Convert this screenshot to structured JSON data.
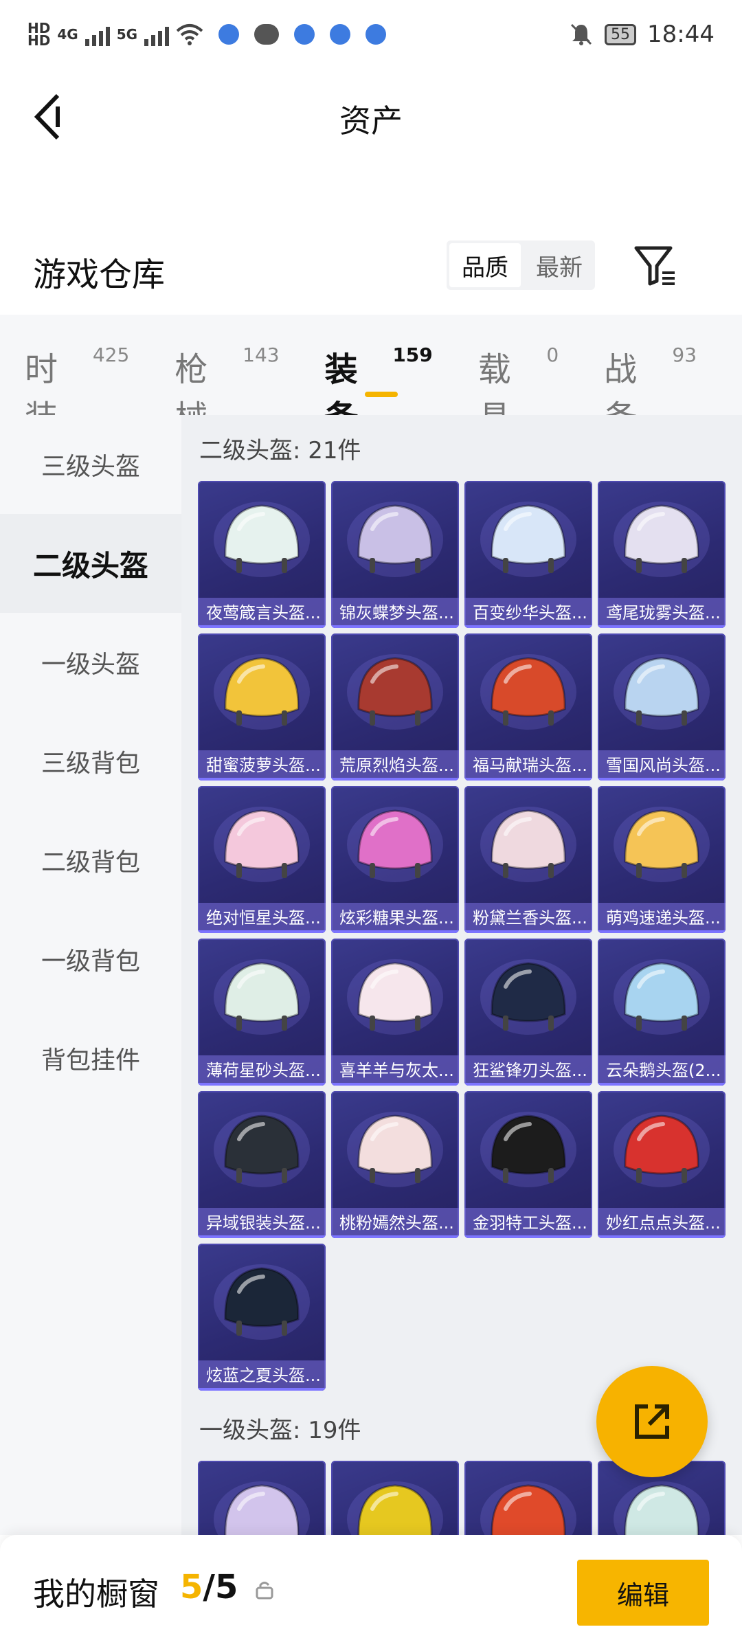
{
  "status_bar": {
    "hd1": "HD",
    "hd2": "HD",
    "net1": "4G",
    "net2": "5G",
    "battery": "55",
    "time": "18:44"
  },
  "header": {
    "title": "资产"
  },
  "warehouse": {
    "title": "游戏仓库",
    "sort_options": [
      "品质",
      "最新"
    ],
    "active_sort": "品质"
  },
  "tabs": [
    {
      "label": "时装",
      "count": "425"
    },
    {
      "label": "枪械",
      "count": "143"
    },
    {
      "label": "装备",
      "count": "159",
      "active": true
    },
    {
      "label": "载具",
      "count": "0"
    },
    {
      "label": "战备",
      "count": "93"
    }
  ],
  "sidebar": {
    "items": [
      "三级头盔",
      "二级头盔",
      "一级头盔",
      "三级背包",
      "二级背包",
      "一级背包",
      "背包挂件"
    ],
    "active": "二级头盔"
  },
  "sections": [
    {
      "title": "二级头盔: 21件",
      "items": [
        {
          "name": "夜莺箴言头盔...",
          "color": "#e6f2ee"
        },
        {
          "name": "锦灰蝶梦头盔...",
          "color": "#c9c0e6"
        },
        {
          "name": "百变纱华头盔...",
          "color": "#d8e6f8"
        },
        {
          "name": "鸢尾珑雾头盔...",
          "color": "#e4e0f0"
        },
        {
          "name": "甜蜜菠萝头盔...",
          "color": "#f2c43a"
        },
        {
          "name": "荒原烈焰头盔...",
          "color": "#a83a30"
        },
        {
          "name": "福马献瑞头盔...",
          "color": "#d84a2a"
        },
        {
          "name": "雪国风尚头盔...",
          "color": "#b9d4f0"
        },
        {
          "name": "绝对恒星头盔...",
          "color": "#f4c8dc"
        },
        {
          "name": "炫彩糖果头盔...",
          "color": "#e070c8"
        },
        {
          "name": "粉黛兰香头盔...",
          "color": "#efd9df"
        },
        {
          "name": "萌鸡速递头盔...",
          "color": "#f5c456"
        },
        {
          "name": "薄荷星砂头盔...",
          "color": "#dfeee6"
        },
        {
          "name": "喜羊羊与灰太...",
          "color": "#f6e6ec"
        },
        {
          "name": "狂鲨锋刃头盔...",
          "color": "#1f2a46"
        },
        {
          "name": "云朵鹅头盔(2...",
          "color": "#a8d4f0"
        },
        {
          "name": "异域银装头盔...",
          "color": "#2a3038"
        },
        {
          "name": "桃粉嫣然头盔...",
          "color": "#f3dede"
        },
        {
          "name": "金羽特工头盔...",
          "color": "#1c1c1c"
        },
        {
          "name": "妙红点点头盔...",
          "color": "#d8322e"
        },
        {
          "name": "炫蓝之夏头盔...",
          "color": "#1b2638"
        }
      ]
    },
    {
      "title": "一级头盔: 19件",
      "items": [
        {
          "name": "",
          "color": "#d2c4ec"
        },
        {
          "name": "",
          "color": "#e6c820"
        },
        {
          "name": "",
          "color": "#e04a2a"
        },
        {
          "name": "",
          "color": "#cfe8e4"
        }
      ]
    }
  ],
  "bottom_bar": {
    "label": "我的橱窗",
    "count_current": "5",
    "count_sep": "/",
    "count_total": "5",
    "edit_label": "编辑"
  },
  "colors": {
    "accent": "#f5b400",
    "card_bg": "#2f2c78",
    "card_label_bg": "#7a6ee0"
  },
  "icons": {
    "back": "chevron-left-icon",
    "filter": "filter-icon",
    "share": "share-external-icon",
    "lock": "lock-icon"
  }
}
